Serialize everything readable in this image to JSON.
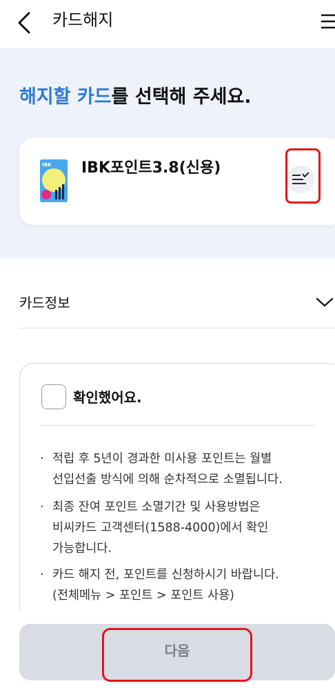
{
  "header": {
    "title": "카드해지",
    "back_icon": "back-arrow-icon",
    "menu_icon": "hamburger-menu-icon"
  },
  "hero": {
    "headline_accent": "해지할 카드",
    "headline_rest": "를 선택해 주세요.",
    "accent_color": "#2f7ad8",
    "background_color": "#eef2fa"
  },
  "selected_card": {
    "name": "IBK포인트3.8(신용)",
    "thumb_brand": "IBK",
    "sort_icon": "sort-list-icon"
  },
  "card_info": {
    "label": "카드정보",
    "chevron_icon": "chevron-down-icon"
  },
  "confirm": {
    "checkbox_label": "확인했어요.",
    "checked": false
  },
  "notes": [
    {
      "bullet": "·",
      "text_line1": "적립 후 5년이 경과한 미사용 포인트는 월별",
      "text_line2": "선입선출 방식에 의해 순차적으로 소멸됩니다.",
      "text_line3": ""
    },
    {
      "bullet": "·",
      "text_line1": "최종 잔여 포인트 소멸기간 및 사용방법은",
      "text_line2": "비씨카드 고객센터(1588-4000)에서 확인",
      "text_line3": "가능합니다."
    },
    {
      "bullet": "·",
      "text_line1": "카드 해지 전, 포인트를 신청하시기 바랍니다.",
      "text_line2": "(전체메뉴 > 포인트 > 포인트 사용)",
      "text_line3": ""
    }
  ],
  "footer": {
    "next_label": "다음",
    "button_color": "#d9dce4"
  },
  "annotation_color": "#e0141e"
}
